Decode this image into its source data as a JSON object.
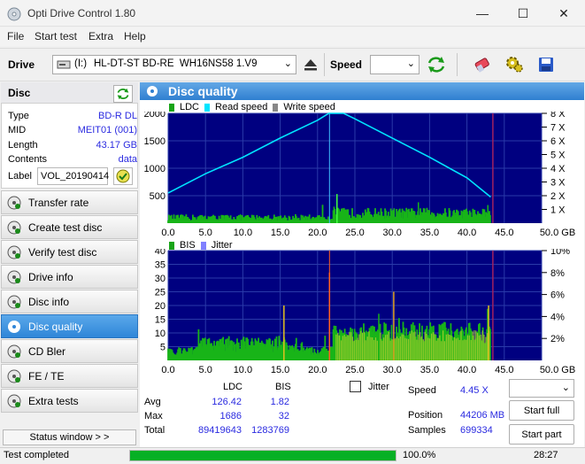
{
  "window": {
    "title": "Opti Drive Control 1.80",
    "min": "—",
    "max": "☐",
    "close": "✕"
  },
  "menu": [
    "File",
    "Start test",
    "Extra",
    "Help"
  ],
  "toolbar": {
    "drive_label": "Drive",
    "drive_letter": "(I:)",
    "drive_name": "HL-DT-ST BD-RE  WH16NS58 1.V9",
    "speed_label": "Speed",
    "speed_value": ""
  },
  "disc": {
    "header": "Disc",
    "rows": [
      {
        "k": "Type",
        "v": "BD-R DL"
      },
      {
        "k": "MID",
        "v": "MEIT01 (001)"
      },
      {
        "k": "Length",
        "v": "43.17 GB"
      },
      {
        "k": "Contents",
        "v": "data"
      }
    ],
    "label_key": "Label",
    "label_value": "VOL_20190414"
  },
  "nav": [
    {
      "label": "Transfer rate",
      "active": false
    },
    {
      "label": "Create test disc",
      "active": false
    },
    {
      "label": "Verify test disc",
      "active": false
    },
    {
      "label": "Drive info",
      "active": false
    },
    {
      "label": "Disc info",
      "active": false
    },
    {
      "label": "Disc quality",
      "active": true
    },
    {
      "label": "CD Bler",
      "active": false
    },
    {
      "label": "FE / TE",
      "active": false
    },
    {
      "label": "Extra tests",
      "active": false
    }
  ],
  "status_window_btn": "Status window > >",
  "main_title": "Disc quality",
  "chart_data": [
    {
      "type": "bar",
      "legend": [
        "LDC",
        "Read speed",
        "Write speed"
      ],
      "colors": {
        "LDC": "#18a418",
        "Read speed": "#00e5ff",
        "Write speed": "#888888",
        "bg": "#000080",
        "grid": "#2a3aa8"
      },
      "x_ticks": [
        "0.0",
        "5.0",
        "10.0",
        "15.0",
        "20.0",
        "25.0",
        "30.0",
        "35.0",
        "40.0",
        "45.0",
        "50.0 GB"
      ],
      "y_ticks_left": [
        "2000",
        "1500",
        "1000",
        "500"
      ],
      "y_ticks_right": [
        "8 X",
        "7 X",
        "6 X",
        "5 X",
        "4 X",
        "3 X",
        "2 X",
        "1 X"
      ],
      "xlim": [
        0,
        50
      ],
      "ylim": [
        0,
        2000
      ],
      "y2lim": [
        0,
        8
      ],
      "read_speed": {
        "x": [
          0,
          5,
          10,
          15,
          20,
          21.5,
          23.5,
          25,
          30,
          35,
          40,
          43.17
        ],
        "y": [
          2.2,
          3.6,
          4.8,
          6.2,
          7.5,
          8.0,
          8.0,
          7.6,
          6.2,
          4.8,
          3.3,
          1.9
        ]
      },
      "layer_break": 21.6,
      "ldc_max": 1686
    },
    {
      "type": "bar",
      "legend": [
        "BIS",
        "Jitter"
      ],
      "colors": {
        "BIS": "#18a418",
        "Jitter": "#8080ff"
      },
      "x_ticks": [
        "0.0",
        "5.0",
        "10.0",
        "15.0",
        "20.0",
        "25.0",
        "30.0",
        "35.0",
        "40.0",
        "45.0",
        "50.0 GB"
      ],
      "y_ticks_left": [
        "40",
        "35",
        "30",
        "25",
        "20",
        "15",
        "10",
        "5"
      ],
      "y_ticks_right": [
        "10%",
        "8%",
        "6%",
        "4%",
        "2%"
      ],
      "xlim": [
        0,
        50
      ],
      "ylim": [
        0,
        40
      ],
      "bis_max": 32
    }
  ],
  "stats": {
    "col_ldc": "LDC",
    "col_bis": "BIS",
    "rows": [
      {
        "k": "Avg",
        "ldc": "126.42",
        "bis": "1.82"
      },
      {
        "k": "Max",
        "ldc": "1686",
        "bis": "32"
      },
      {
        "k": "Total",
        "ldc": "89419643",
        "bis": "1283769"
      }
    ],
    "jitter_label": "Jitter",
    "speed_k": "Speed",
    "speed_v": "4.45 X",
    "position_k": "Position",
    "position_v": "44206 MB",
    "samples_k": "Samples",
    "samples_v": "699334",
    "start_full": "Start full",
    "start_part": "Start part"
  },
  "statusbar": {
    "text": "Test completed",
    "progress": 1.0,
    "percent": "100.0%",
    "time": "28:27"
  }
}
